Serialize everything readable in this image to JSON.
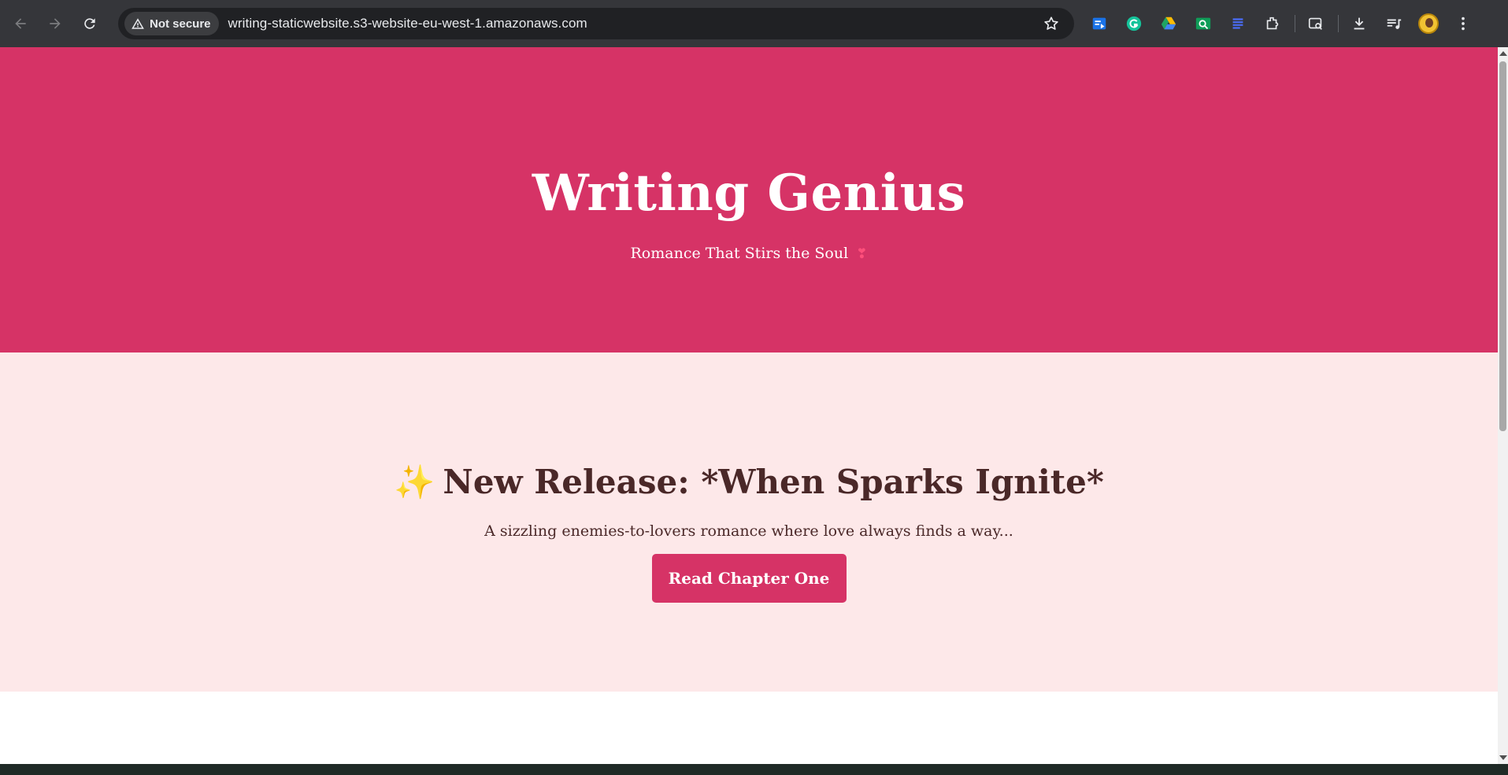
{
  "browser": {
    "security_chip": "Not secure",
    "url": "writing-staticwebsite.s3-website-eu-west-1.amazonaws.com",
    "extensions": [
      "tab-manager-icon",
      "grammarly-icon",
      "google-drive-icon",
      "search-ext-icon",
      "list-ext-icon",
      "extensions-puzzle-icon",
      "tab-search-icon",
      "download-icon",
      "media-control-icon",
      "profile-avatar",
      "menu-dots-icon"
    ]
  },
  "hero": {
    "title": "Writing Genius",
    "tagline": "Romance That Stirs the Soul",
    "tagline_emoji": "❣"
  },
  "release": {
    "emoji": "✨",
    "heading": "New Release: *When Sparks Ignite*",
    "blurb": "A sizzling enemies-to-lovers romance where love always finds a way...",
    "button_label": "Read Chapter One"
  },
  "colors": {
    "brand": "#d63366",
    "release_bg": "#fde8e9",
    "text_dark": "#4a2828"
  }
}
